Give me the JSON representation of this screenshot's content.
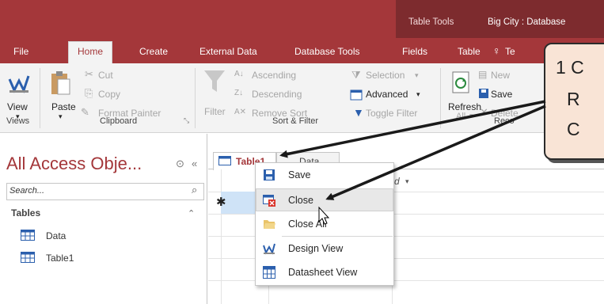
{
  "quick_access": {
    "save_icon": "save-icon",
    "undo_icon": "undo-icon",
    "redo_icon": "redo-icon",
    "open_icon": "folder-open-icon",
    "customize_icon": "customize-qat-icon"
  },
  "title_bar": {
    "contextual_label": "Table Tools",
    "app_title": "Big City : Database"
  },
  "ribbon_tabs": [
    "File",
    "Home",
    "Create",
    "External Data",
    "Database Tools",
    "Fields",
    "Table"
  ],
  "tell_me": {
    "icon": "lightbulb-icon",
    "label": "Te"
  },
  "ribbon": {
    "view": {
      "label": "View",
      "group": "Views"
    },
    "clipboard": {
      "paste": "Paste",
      "cut": "Cut",
      "copy": "Copy",
      "format_painter": "Format Painter",
      "group": "Clipboard"
    },
    "sort_filter": {
      "filter": "Filter",
      "ascending": "Ascending",
      "descending": "Descending",
      "remove_sort": "Remove Sort",
      "selection": "Selection",
      "advanced": "Advanced",
      "toggle_filter": "Toggle Filter",
      "group": "Sort & Filter"
    },
    "records": {
      "refresh": "Refresh",
      "refresh_sub": "All",
      "new": "New",
      "save": "Save",
      "delete": "Delete",
      "group": "Reco"
    }
  },
  "nav_pane": {
    "title": "All Access Obje...",
    "search_placeholder": "Search...",
    "section": "Tables",
    "items": [
      {
        "label": "Data",
        "icon": "table-icon"
      },
      {
        "label": "Table1",
        "icon": "table-icon"
      }
    ]
  },
  "doc_tabs": [
    {
      "label": "Table1"
    },
    {
      "label": "Data"
    }
  ],
  "grid": {
    "header_fragment": "d",
    "new_row_marker": "✱"
  },
  "context_menu": [
    {
      "label": "Save",
      "icon": "save-icon"
    },
    {
      "label": "Close",
      "icon": "close-icon",
      "highlighted": true
    },
    {
      "label": "Close All",
      "icon": "close-all-icon"
    },
    {
      "label": "Design View",
      "icon": "design-view-icon"
    },
    {
      "label": "Datasheet View",
      "icon": "datasheet-view-icon"
    }
  ],
  "callout": {
    "lines": [
      "1 C",
      "R",
      "C"
    ]
  },
  "colors": {
    "access_red": "#a4373a",
    "contextual_dark": "#7d2b2e",
    "ribbon_bg": "#f3f3f3",
    "callout_fill": "#f9e4d6"
  }
}
